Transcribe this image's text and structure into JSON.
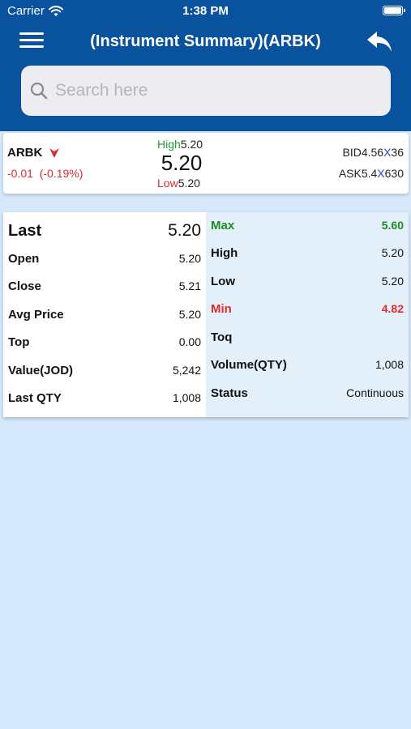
{
  "status_bar": {
    "carrier": "Carrier",
    "time": "1:38 PM"
  },
  "nav": {
    "title": "(Instrument Summary)(ARBK)"
  },
  "search": {
    "placeholder": "Search here"
  },
  "quote": {
    "symbol": "ARBK",
    "change": "-0.01",
    "change_pct": "(-0.19%)",
    "high_label": "High",
    "high_value": "5.20",
    "last_price": "5.20",
    "low_label": "Low",
    "low_value": "5.20",
    "bid_label": "BID",
    "bid_price": "4.56",
    "bid_x": "X",
    "bid_qty": "36",
    "ask_label": "ASK",
    "ask_price": "5.4",
    "ask_x": "X",
    "ask_qty": "630"
  },
  "details": {
    "left": [
      {
        "label": "Last",
        "value": "5.20"
      },
      {
        "label": "Open",
        "value": "5.20"
      },
      {
        "label": "Close",
        "value": "5.21"
      },
      {
        "label": "Avg Price",
        "value": "5.20"
      },
      {
        "label": "Top",
        "value": "0.00"
      },
      {
        "label": "Value(JOD)",
        "value": "5,242"
      },
      {
        "label": "Last QTY",
        "value": "1,008"
      }
    ],
    "right": [
      {
        "label": "Max",
        "value": "5.60"
      },
      {
        "label": "High",
        "value": "5.20"
      },
      {
        "label": "Low",
        "value": "5.20"
      },
      {
        "label": "Min",
        "value": "4.82"
      },
      {
        "label": "Toq",
        "value": ""
      },
      {
        "label": "Volume(QTY)",
        "value": "1,008"
      },
      {
        "label": "Status",
        "value": "Continuous"
      }
    ]
  },
  "colors": {
    "header": "#08529e",
    "background": "#d6e8fb",
    "positive": "#1e8a25",
    "negative": "#e02b2b",
    "right_panel": "#e3f0fa"
  },
  "icons": [
    "menu-icon",
    "back-arrow-icon",
    "search-icon",
    "down-arrow-icon",
    "wifi-icon",
    "battery-icon"
  ]
}
